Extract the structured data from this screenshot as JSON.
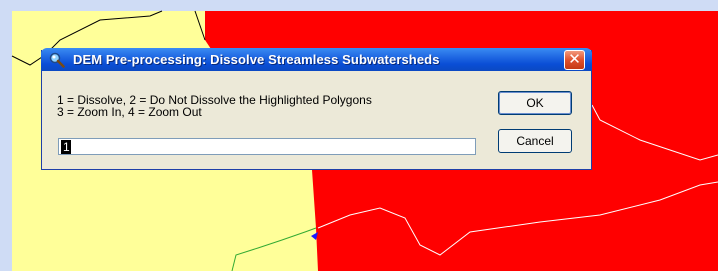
{
  "dialog": {
    "title": "DEM Pre-processing: Dissolve Streamless Subwatersheds",
    "close_label": "✕",
    "message_line1": "1 = Dissolve, 2 = Do Not Dissolve the Highlighted Polygons",
    "message_line2": "3 = Zoom In, 4 = Zoom Out",
    "input_value": "1",
    "ok_label": "OK",
    "cancel_label": "Cancel"
  },
  "map": {
    "colors": {
      "background_border": "#cfdcf5",
      "land": "#ffff99",
      "highlighted_polygon": "#ff0000",
      "boundary_line": "#000000",
      "stream_line": "#33aa33",
      "marker": "#1a1aff"
    }
  },
  "icons": {
    "title_icon": "magnifier-icon",
    "close_icon": "close-icon"
  }
}
